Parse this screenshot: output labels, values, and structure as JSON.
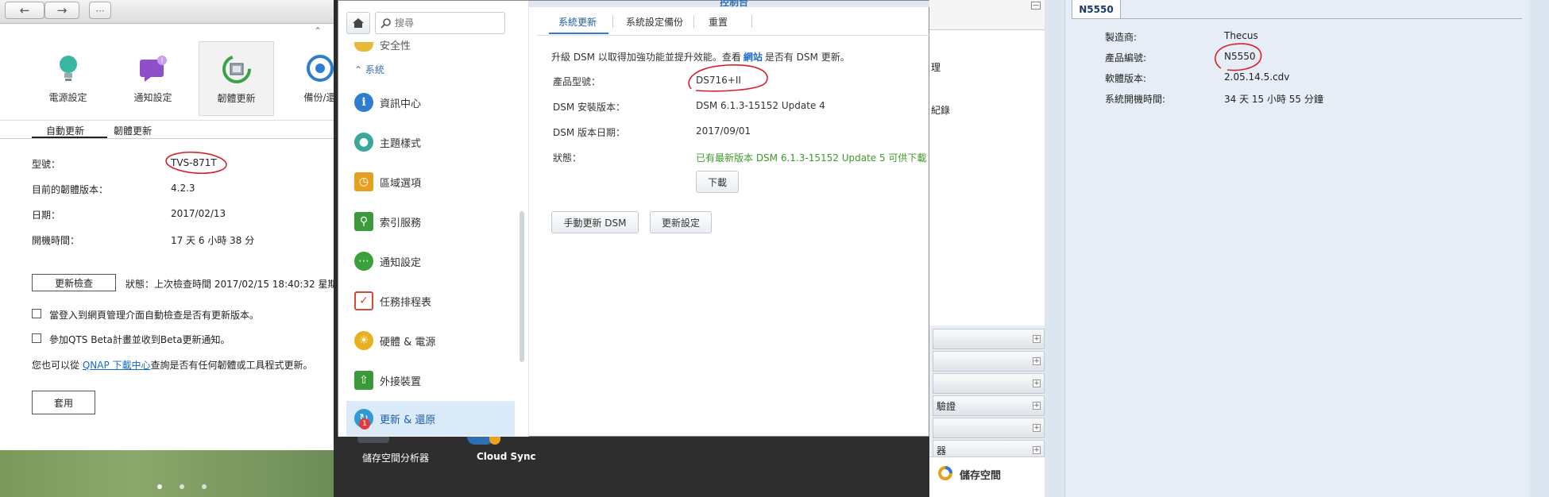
{
  "qnap": {
    "icons": [
      {
        "label": "電源設定",
        "icon": "lightbulb-icon"
      },
      {
        "label": "通知設定",
        "icon": "notification-icon"
      },
      {
        "label": "韌體更新",
        "icon": "firmware-update-icon"
      },
      {
        "label": "備份/還",
        "icon": "backup-icon"
      }
    ],
    "tabs": [
      "自動更新",
      "韌體更新"
    ],
    "rows": [
      {
        "label": "型號：",
        "value": "TVS-871T"
      },
      {
        "label": "目前的韌體版本：",
        "value": "4.2.3"
      },
      {
        "label": "日期：",
        "value": "2017/02/13"
      },
      {
        "label": "開機時間：",
        "value": "17 天 6 小時 38 分"
      }
    ],
    "check_button": "更新檢查",
    "status_text": "狀態：上次檢查時間 2017/02/15 18:40:32 星期",
    "checkbox1": "當登入到網頁管理介面自動檢查是否有更新版本。",
    "checkbox2": "參加QTS Beta計畫並收到Beta更新通知。",
    "hint_prefix": "您也可以從 ",
    "hint_link": "QNAP 下載中心",
    "hint_suffix": "查詢是否有任何韌體或工具程式更新。",
    "apply_button": "套用"
  },
  "syno": {
    "title": "控制台",
    "search_placeholder": "搜尋",
    "partial_item": "安全性",
    "section": "系統",
    "sidebar": [
      {
        "label": "資訊中心",
        "icon": "info-icon",
        "color": "#2f7dd1"
      },
      {
        "label": "主題樣式",
        "icon": "palette-icon",
        "color": "#3aa79a"
      },
      {
        "label": "區域選項",
        "icon": "calendar-clock-icon",
        "color": "#e4a020"
      },
      {
        "label": "索引服務",
        "icon": "search-index-icon",
        "color": "#3b9a3b"
      },
      {
        "label": "通知設定",
        "icon": "chat-icon",
        "color": "#3aa03a"
      },
      {
        "label": "任務排程表",
        "icon": "task-icon",
        "color": "#d24a3a"
      },
      {
        "label": "硬體 & 電源",
        "icon": "bulb-icon",
        "color": "#e8b020"
      },
      {
        "label": "外接裝置",
        "icon": "external-device-icon",
        "color": "#3a9a3a"
      },
      {
        "label": "更新 & 還原",
        "icon": "update-restore-icon",
        "color": "#2f9ad1"
      }
    ],
    "badge": "1",
    "tabs": [
      "系統更新",
      "系統設定備份",
      "重置"
    ],
    "intro_prefix": "升級 DSM 以取得加強功能並提升效能。查看",
    "intro_link": "網站",
    "intro_suffix": "是否有 DSM 更新。",
    "rows": [
      {
        "label": "產品型號：",
        "value": "DS716+II"
      },
      {
        "label": "DSM 安裝版本：",
        "value": "DSM 6.1.3-15152 Update 4"
      },
      {
        "label": "DSM 版本日期：",
        "value": "2017/09/01"
      },
      {
        "label": "狀態：",
        "value": "已有最新版本 DSM 6.1.3-15152 Update 5 可供下載"
      }
    ],
    "download_button": "下載",
    "manual_button": "手動更新 DSM",
    "settings_button": "更新設定",
    "dock": [
      "儲存空間分析器",
      "Cloud Sync"
    ]
  },
  "middle": {
    "fragments": [
      "理",
      "紀錄"
    ],
    "rows": [
      "",
      "",
      "",
      "驗證",
      "",
      "器",
      ""
    ],
    "storage_label": "儲存空間"
  },
  "thecus": {
    "tab": "N5550",
    "rows": [
      {
        "label": "製造商:",
        "value": "Thecus"
      },
      {
        "label": "產品編號:",
        "value": "N5550"
      },
      {
        "label": "軟體版本:",
        "value": "2.05.14.5.cdv"
      },
      {
        "label": "系統開機時間:",
        "value": "34 天 15 小時 55 分鐘"
      }
    ]
  }
}
